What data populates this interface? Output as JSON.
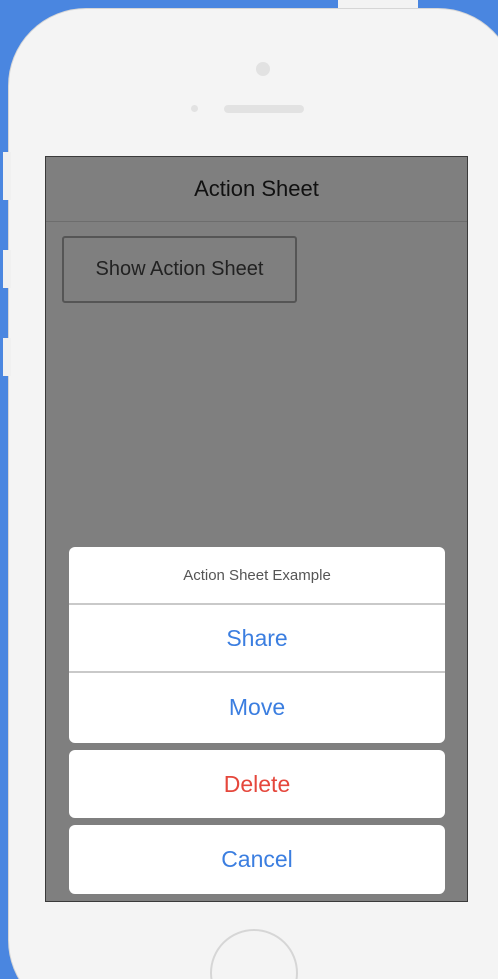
{
  "navigation": {
    "title": "Action Sheet"
  },
  "main": {
    "show_button_label": "Show Action Sheet"
  },
  "action_sheet": {
    "title": "Action Sheet Example",
    "options": [
      {
        "label": "Share",
        "style": "default"
      },
      {
        "label": "Move",
        "style": "default"
      }
    ],
    "destructive": {
      "label": "Delete"
    },
    "cancel": {
      "label": "Cancel"
    }
  },
  "colors": {
    "accent": "#3b7ee0",
    "destructive": "#e5473c",
    "overlay": "#7f7f7f",
    "background": "#4a86e0"
  }
}
